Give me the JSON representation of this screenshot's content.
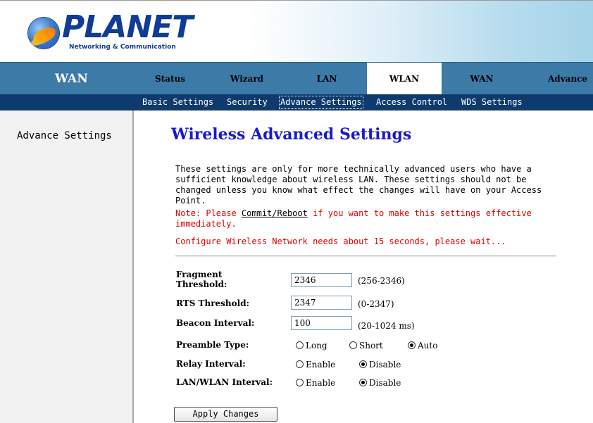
{
  "brand": {
    "name": "PLANET",
    "tagline": "Networking & Communication"
  },
  "nav": {
    "section_title": "WAN",
    "tabs": [
      "Status",
      "Wizard",
      "LAN",
      "WLAN",
      "WAN",
      "Advance"
    ],
    "active_tab": "WLAN"
  },
  "subnav": {
    "items": [
      "Basic Settings",
      "Security",
      "Advance Settings",
      "Access Control",
      "WDS Settings"
    ],
    "active": "Advance Settings"
  },
  "sidebar": {
    "items": [
      "Advance Settings"
    ]
  },
  "page": {
    "title": "Wireless Advanced Settings",
    "description": "These settings are only for more technically advanced users who have a sufficient knowledge about wireless LAN. These settings should not be changed unless you know what effect the changes will have on your Access Point.",
    "note_prefix": "Note: Please ",
    "note_link": "Commit/Reboot",
    "note_suffix": " if you want to make this settings effective immediately.",
    "config_wait": "Configure Wireless Network needs about 15 seconds, please wait..."
  },
  "form": {
    "fragment_threshold": {
      "label": "Fragment Threshold:",
      "value": "2346",
      "range": "(256-2346)"
    },
    "rts_threshold": {
      "label": "RTS Threshold:",
      "value": "2347",
      "range": "(0-2347)"
    },
    "beacon_interval": {
      "label": "Beacon Interval:",
      "value": "100",
      "range": "(20-1024 ms)"
    },
    "preamble_type": {
      "label": "Preamble Type:",
      "options": [
        "Long",
        "Short",
        "Auto"
      ],
      "selected": "Auto"
    },
    "relay_interval": {
      "label": "Relay Interval:",
      "options": [
        "Enable",
        "Disable"
      ],
      "selected": "Disable"
    },
    "lan_wlan_interval": {
      "label": "LAN/WLAN Interval:",
      "options": [
        "Enable",
        "Disable"
      ],
      "selected": "Disable"
    },
    "apply_label": "Apply Changes"
  },
  "colors": {
    "nav_bar": "#3c7aa8",
    "subnav_bar": "#0f3a6d",
    "title_blue": "#1a1acc",
    "note_red": "#e00000"
  }
}
